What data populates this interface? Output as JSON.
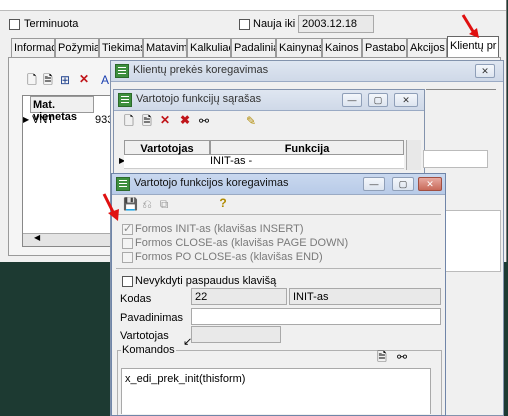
{
  "main": {
    "terminuota_label": "Terminuota",
    "nauja_iki_label": "Nauja iki",
    "nauja_iki_value": "2003.12.18",
    "tabs": [
      {
        "label": "Informac"
      },
      {
        "label": "Požymiai"
      },
      {
        "label": "Tiekimas"
      },
      {
        "label": "Matavimo"
      },
      {
        "label": "Kalkuliac"
      },
      {
        "label": "Padalinia"
      },
      {
        "label": "Kainynas"
      },
      {
        "label": "Kainos"
      },
      {
        "label": "Pastabos"
      },
      {
        "label": "Akcijos"
      },
      {
        "label": "Klientų pr"
      }
    ],
    "grid": {
      "header": "Mat. vienetas",
      "row_value": "VNT",
      "row_value2": "933"
    }
  },
  "win_kpk": {
    "title": "Klientų prekės koregavimas"
  },
  "win_vfs": {
    "title": "Vartotojo funkcijų sąrašas",
    "columns": [
      "Vartotojas",
      "Funkcija"
    ],
    "row": {
      "vartotojas": "",
      "funkcija": "INIT-as -"
    }
  },
  "win_vfk": {
    "title": "Vartotojo funkcijos koregavimas",
    "options": [
      {
        "label": "Formos INIT-as (klavišas INSERT)",
        "checked": true
      },
      {
        "label": "Formos CLOSE-as (klavišas PAGE DOWN)",
        "checked": false
      },
      {
        "label": "Formos PO CLOSE-as (klavišas END)",
        "checked": false
      }
    ],
    "ignore_label": "Nevykdyti paspaudus klavišą",
    "kodas_label": "Kodas",
    "kodas_value": "22",
    "kodas_name": "INIT-as",
    "pavadinimas_label": "Pavadinimas",
    "pavadinimas_value": "",
    "vartotojas_label": "Vartotojas",
    "vartotojas_value": "",
    "komandos_label": "Komandos",
    "komandos_value": "x_edi_prek_init(thisform)"
  },
  "colors": {
    "desktop": "#1d3a32",
    "arrow": "#e01010",
    "titlebar": "#c9d8ef"
  }
}
